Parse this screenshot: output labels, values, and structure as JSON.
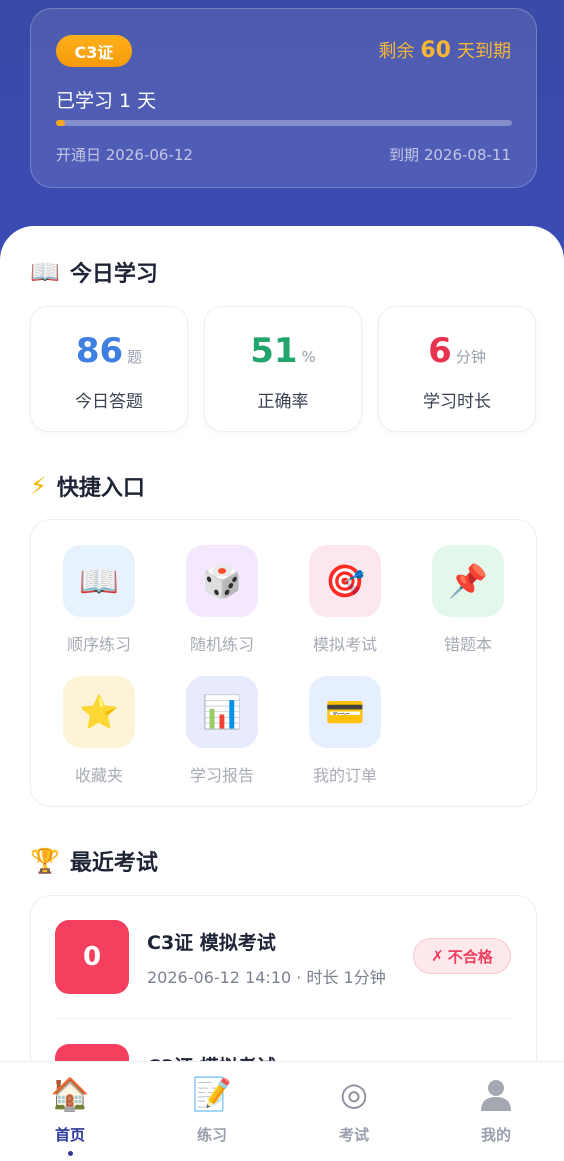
{
  "subscription": {
    "badge": "C3证",
    "remain_prefix": "剩余",
    "remain_days": "60",
    "remain_suffix": "天到期",
    "learned": "已学习 1 天",
    "progress": 0.02,
    "open_date": "开通日 2026-06-12",
    "due_date": "到期 2026-08-11"
  },
  "today": {
    "title": "今日学习",
    "title_icon": "open-book-icon",
    "stats": [
      {
        "value": "86",
        "unit": "题",
        "label": "今日答题",
        "color": "#3f7fe0"
      },
      {
        "value": "51",
        "unit": "%",
        "label": "正确率",
        "color": "#22a66e"
      },
      {
        "value": "6",
        "unit": "分钟",
        "label": "学习时长",
        "color": "#e8334f"
      }
    ]
  },
  "quick": {
    "title": "快捷入口",
    "title_icon": "lightning-icon",
    "items": [
      {
        "label": "顺序练习",
        "icon": "book-icon",
        "bg": "#e6f2fd"
      },
      {
        "label": "随机练习",
        "icon": "dice-icon",
        "bg": "#f3e8fd"
      },
      {
        "label": "模拟考试",
        "icon": "target-icon",
        "bg": "#fde7ef"
      },
      {
        "label": "错题本",
        "icon": "pushpin-icon",
        "bg": "#e3f8ea"
      },
      {
        "label": "收藏夹",
        "icon": "star-icon",
        "bg": "#fdf3d6"
      },
      {
        "label": "学习报告",
        "icon": "bar-chart-icon",
        "bg": "#e8eafd"
      },
      {
        "label": "我的订单",
        "icon": "credit-card-icon",
        "bg": "#e6effd"
      }
    ]
  },
  "recent": {
    "title": "最近考试",
    "title_icon": "trophy-icon",
    "exams": [
      {
        "score": "0",
        "name": "C3证 模拟考试",
        "meta": "2026-06-12 14:10 · 时长 1分钟",
        "status": "不合格"
      },
      {
        "score": "0",
        "name": "C3证 模拟考试"
      }
    ]
  },
  "tabs": [
    {
      "label": "首页",
      "icon": "house-icon",
      "active": true
    },
    {
      "label": "练习",
      "icon": "memo-icon",
      "active": false
    },
    {
      "label": "考试",
      "icon": "target-icon",
      "active": false
    },
    {
      "label": "我的",
      "icon": "user-icon",
      "active": false
    }
  ]
}
